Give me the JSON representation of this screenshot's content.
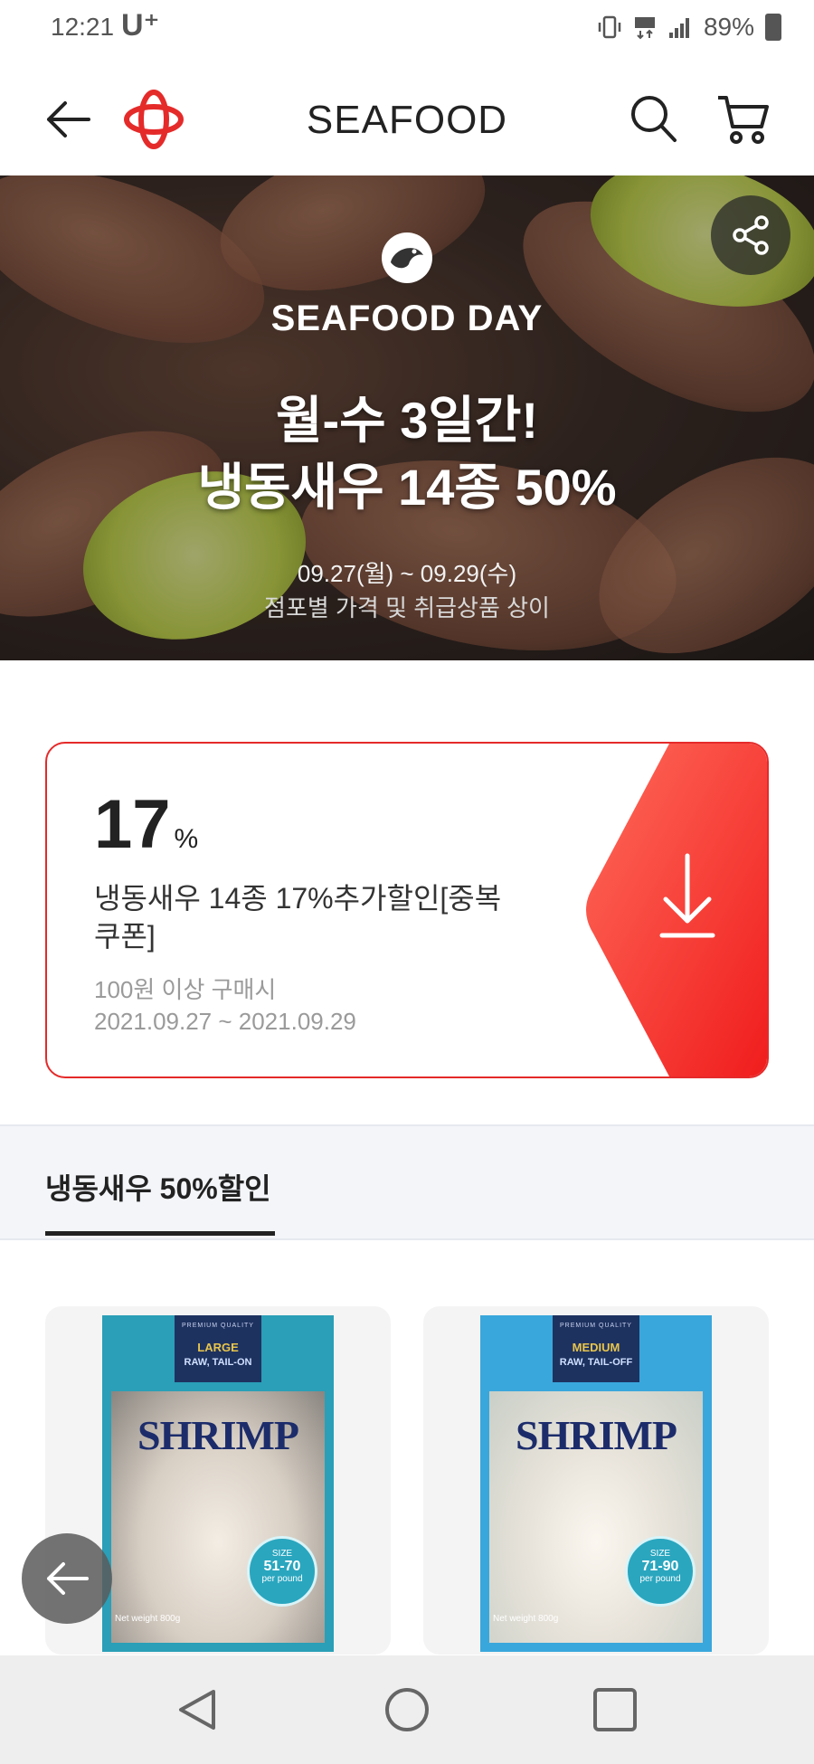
{
  "status_bar": {
    "time": "12:21",
    "carrier": "U⁺",
    "battery": "89%"
  },
  "header": {
    "title": "SEAFOOD"
  },
  "hero": {
    "brand": "SEAFOOD DAY",
    "headline1": "월-수 3일간!",
    "headline2": "냉동새우 14종 50%",
    "dates": "09.27(월) ~ 09.29(수)",
    "note": "점포별 가격 및 취급상품 상이"
  },
  "coupon": {
    "percent": "17",
    "percent_unit": "%",
    "desc_line1": "냉동새우 14종 17%추가할인[중복",
    "desc_line2": "쿠폰]",
    "condition": "100원 이상 구매시",
    "period": "2021.09.27 ~ 2021.09.29"
  },
  "tabs": {
    "active": "냉동새우 50%할인"
  },
  "products": [
    {
      "band_top": "PREMIUM QUALITY",
      "size_label": "LARGE",
      "style_label": "RAW, TAIL-ON",
      "name": "SHRIMP",
      "badge_title": "SIZE",
      "badge_count": "51-70",
      "badge_unit": "per pound",
      "net_weight": "Net weight 800g",
      "accent": "#2a9fb7"
    },
    {
      "band_top": "PREMIUM QUALITY",
      "size_label": "MEDIUM",
      "style_label": "RAW, TAIL-OFF",
      "name": "SHRIMP",
      "badge_title": "SIZE",
      "badge_count": "71-90",
      "badge_unit": "per pound",
      "net_weight": "Net weight 800g",
      "accent": "#3aa7dc"
    }
  ],
  "colors": {
    "brand_red": "#e52a2a",
    "text": "#222222",
    "muted": "#9a9a9a"
  },
  "icons": [
    "back-arrow-icon",
    "brand-logo-icon",
    "search-icon",
    "cart-icon",
    "share-icon",
    "download-icon",
    "floating-back-icon",
    "nav-back-icon",
    "nav-home-icon",
    "nav-recents-icon"
  ]
}
